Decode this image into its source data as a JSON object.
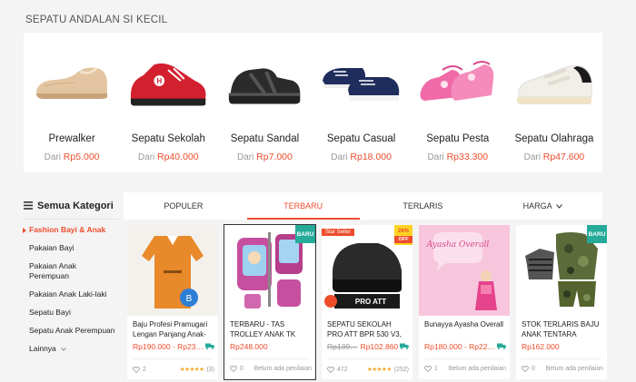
{
  "section": {
    "title": "SEPATU ANDALAN SI KECIL"
  },
  "shoe_categories": [
    {
      "name": "Prewalker",
      "from_label": "Dari",
      "price": "Rp5.000",
      "icon": "beige-prewalker-shoe"
    },
    {
      "name": "Sepatu Sekolah",
      "from_label": "Dari",
      "price": "Rp40.000",
      "icon": "red-sneaker"
    },
    {
      "name": "Sepatu Sandal",
      "from_label": "Dari",
      "price": "Rp7.000",
      "icon": "black-sandal"
    },
    {
      "name": "Sepatu Casual",
      "from_label": "Dari",
      "price": "Rp18.000",
      "icon": "navy-slip-on"
    },
    {
      "name": "Sepatu Pesta",
      "from_label": "Dari",
      "price": "Rp33.300",
      "icon": "pink-party-shoe"
    },
    {
      "name": "Sepatu Olahraga",
      "from_label": "Dari",
      "price": "Rp47.600",
      "icon": "white-velcro-sneaker"
    }
  ],
  "sidebar": {
    "title": "Semua Kategori",
    "items": [
      {
        "label": "Fashion Bayi & Anak",
        "active": true
      },
      {
        "label": "Pakaian Bayi"
      },
      {
        "label": "Pakaian Anak Perempuan"
      },
      {
        "label": "Pakaian Anak Laki-laki"
      },
      {
        "label": "Sepatu Bayi"
      },
      {
        "label": "Sepatu Anak Perempuan"
      }
    ],
    "more_label": "Lainnya"
  },
  "tabs": [
    {
      "label": "POPULER"
    },
    {
      "label": "TERBARU",
      "active": true
    },
    {
      "label": "TERLARIS"
    },
    {
      "label": "HARGA",
      "dropdown": true
    }
  ],
  "products": [
    {
      "name": "Baju Profesi Pramugari Lengan Panjang Anak-",
      "price": "Rp190.000 - Rp23…",
      "likes": "2",
      "rating_stars": "★★★★★",
      "rating_count": "(3)"
    },
    {
      "name": "TERBARU - TAS TROLLEY ANAK TK",
      "price": "Rp248.000",
      "likes": "0",
      "rating_text": "Belum ada penilaian",
      "badge": "BARU"
    },
    {
      "name": "SEPATU SEKOLAH PRO ATT BPR 530 V3,",
      "old_price": "Rp139…",
      "price": "Rp102.860",
      "likes": "472",
      "rating_stars": "★★★★★",
      "rating_count": "(252)",
      "badge_star": "Star Seller",
      "badge_disc": "26%",
      "badge_disc_off": "OFF",
      "product_text": "PRO ATT"
    },
    {
      "name": "Bunayya Ayasha Overall",
      "price": "Rp180.000 - Rp22…",
      "likes": "1",
      "rating_text": "Belum ada penilaian",
      "product_text": "Ayasha Overall"
    },
    {
      "name": "STOK TERLARIS BAJU ANAK TENTARA",
      "price": "Rp162.000",
      "likes": "0",
      "rating_text": "Belum ada penilaian",
      "badge": "BARU"
    }
  ],
  "colors": {
    "accent": "#ee4d2d",
    "badge_green": "#26aa99",
    "star": "#f5a623"
  }
}
